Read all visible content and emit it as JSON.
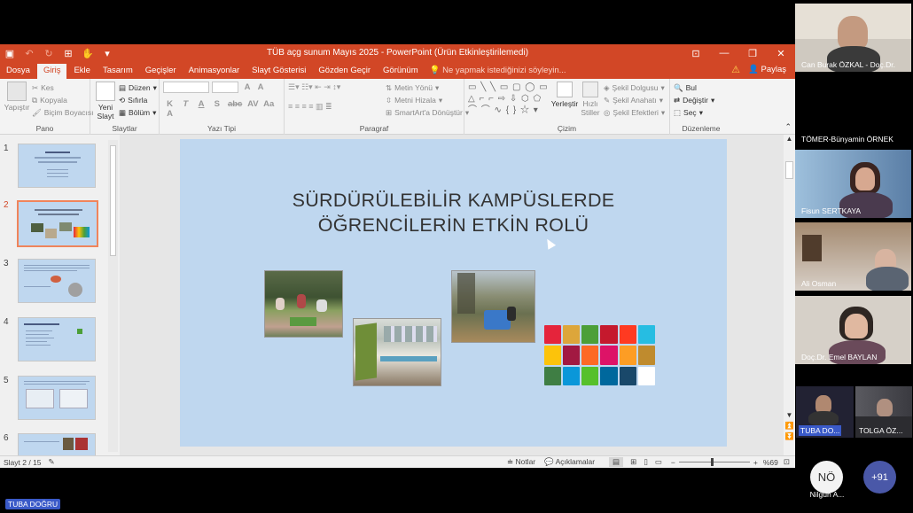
{
  "app": {
    "title": "TÜB açg sunum Mayıs 2025 - PowerPoint (Ürün Etkinleştirilemedi)"
  },
  "tabs": [
    "Dosya",
    "Giriş",
    "Ekle",
    "Tasarım",
    "Geçişler",
    "Animasyonlar",
    "Slayt Gösterisi",
    "Gözden Geçir",
    "Görünüm"
  ],
  "active_tab": "Giriş",
  "tell_me": "Ne yapmak istediğinizi söyleyin...",
  "share": "Paylaş",
  "ribbon": {
    "pano": {
      "label": "Pano",
      "paste": "Yapıştır",
      "cut": "Kes",
      "copy": "Kopyala",
      "format_painter": "Biçim Boyacısı"
    },
    "slides": {
      "label": "Slaytlar",
      "new_slide": "Yeni Slayt",
      "layout": "Düzen",
      "reset": "Sıfırla",
      "section": "Bölüm"
    },
    "font": {
      "label": "Yazı Tipi",
      "buttons": [
        "K",
        "T",
        "A",
        "S",
        "abc",
        "AV",
        "Aa",
        "A"
      ]
    },
    "paragraph": {
      "label": "Paragraf",
      "text_direction": "Metin Yönü",
      "align_text": "Metni Hizala",
      "smartart": "SmartArt'a Dönüştür"
    },
    "drawing": {
      "label": "Çizim",
      "arrange": "Yerleştir",
      "quick_styles": "Hızlı Stiller",
      "shape_fill": "Şekil Dolgusu",
      "shape_outline": "Şekil Anahatı",
      "shape_effects": "Şekil Efektleri"
    },
    "editing": {
      "label": "Düzenleme",
      "find": "Bul",
      "replace": "Değiştir",
      "select": "Seç"
    }
  },
  "thumbnails": [
    {
      "num": "1"
    },
    {
      "num": "2"
    },
    {
      "num": "3"
    },
    {
      "num": "4"
    },
    {
      "num": "5"
    },
    {
      "num": "6"
    }
  ],
  "selected_slide": "2",
  "slide": {
    "title_line1": "SÜRDÜRÜLEBİLİR KAMPÜSLERDE",
    "title_line2": "ÖĞRENCİLERİN ETKİN ROLÜ"
  },
  "status": {
    "slide_position": "Slayt 2 / 15",
    "notes": "Notlar",
    "comments": "Açıklamalar",
    "zoom": "%69"
  },
  "participants": [
    {
      "name": "Can Burak ÖZKAL - Doç.Dr."
    },
    {
      "name": "TÖMER-Bünyamin ÖRNEK"
    },
    {
      "name": "Fisun SERTKAYA"
    },
    {
      "name": "Ali Osman"
    },
    {
      "name": "Doç.Dr. Emel BAYLAN"
    },
    {
      "name": "TUBA DO..."
    },
    {
      "name": "TOLGA ÖZ..."
    }
  ],
  "avatar_tile": {
    "initials": "NÖ",
    "name": "Nilgün A..."
  },
  "more_participants": "+91",
  "self_label": "TUBA DOĞRU",
  "colors": {
    "ppt_accent": "#d24726",
    "slide_bg": "#bfd7ef"
  }
}
